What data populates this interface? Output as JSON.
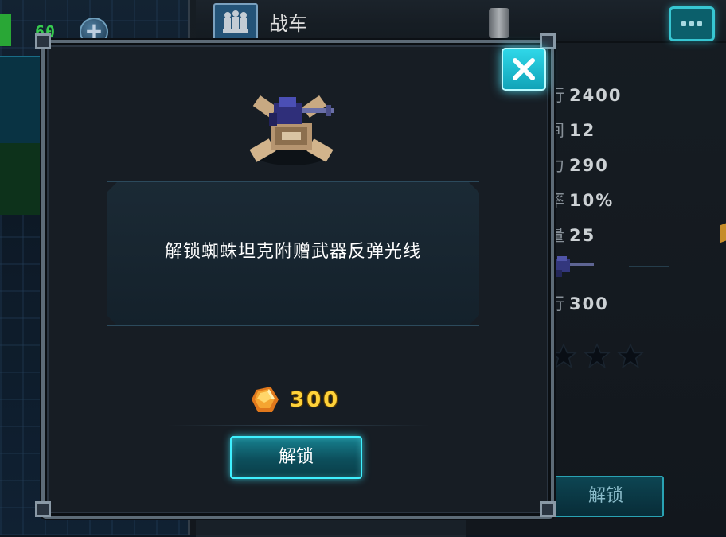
{
  "hud": {
    "energy_value": "60",
    "add_label": "+"
  },
  "header": {
    "title": "战车",
    "icons": {
      "category": "soldiers-icon",
      "canister": "canister-icon",
      "chat": "chat-icon"
    }
  },
  "stats": [
    {
      "prefix": "行",
      "value": "2400"
    },
    {
      "prefix": "间",
      "value": "12"
    },
    {
      "prefix": "力",
      "value": "290"
    },
    {
      "prefix": "率",
      "value": "10%"
    },
    {
      "prefix": "量",
      "value": "25"
    },
    {
      "prefix": "行",
      "value": "300"
    }
  ],
  "rating": {
    "stars_filled": 0,
    "stars_visible": 3
  },
  "background_unlock_label": "解锁",
  "modal": {
    "description": "解锁蜘蛛坦克附赠武器反弹光线",
    "price": "300",
    "currency_icon": "gem-icon",
    "unlock_label": "解锁",
    "close_icon": "close-icon",
    "item_icon": "spider-tank-icon"
  },
  "colors": {
    "accent": "#3ff0ff",
    "price": "#ffd23a",
    "energy": "#3ee65a"
  }
}
